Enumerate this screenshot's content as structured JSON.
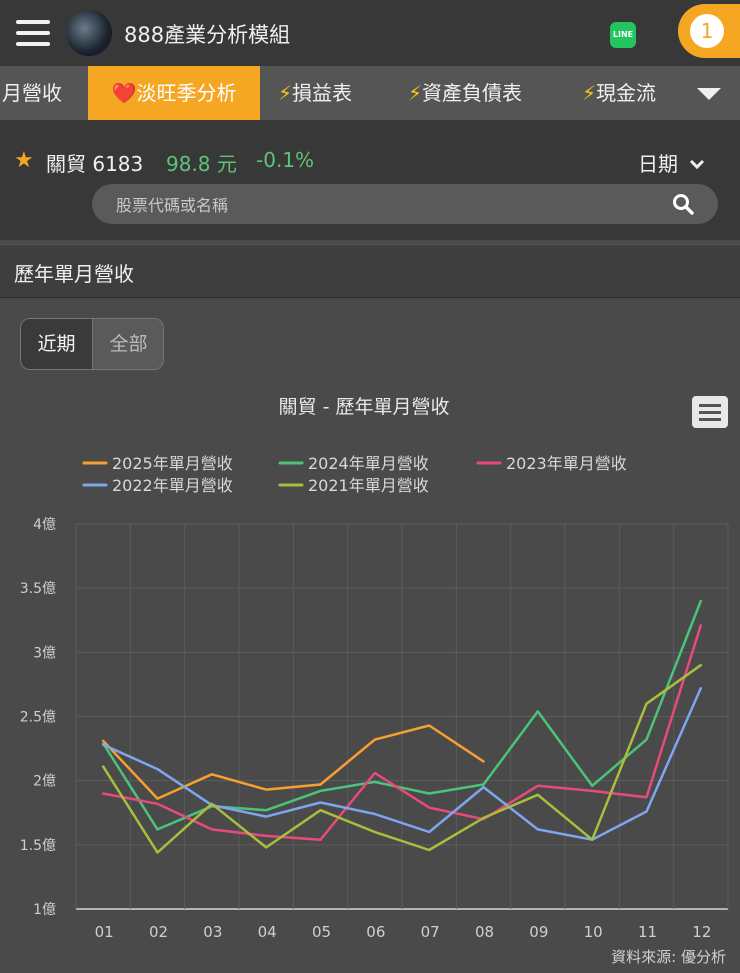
{
  "header": {
    "title": "888產業分析模組",
    "line_badge": "LINE",
    "notification_count": "1"
  },
  "tabs": [
    {
      "label": "月營收",
      "icon": "",
      "active": false
    },
    {
      "label": "淡旺季分析",
      "icon": "❤️",
      "active": true
    },
    {
      "label": "損益表",
      "icon": "⚡",
      "active": false
    },
    {
      "label": "資產負債表",
      "icon": "⚡",
      "active": false
    },
    {
      "label": "現金流",
      "icon": "⚡",
      "active": false
    }
  ],
  "stock": {
    "name": "關貿 6183",
    "price": "98.8 元",
    "change": "-0.1%",
    "date_label": "日期"
  },
  "search": {
    "placeholder": "股票代碼或名稱"
  },
  "section": {
    "title": "歷年單月營收"
  },
  "range_toggle": {
    "recent": "近期",
    "all": "全部"
  },
  "colors": {
    "accent": "#f5a623",
    "up": "#5ec27a"
  },
  "chart_data": {
    "type": "line",
    "title": "關貿 - 歷年單月營收",
    "source": "資料來源: 優分析",
    "categories": [
      "01",
      "02",
      "03",
      "04",
      "05",
      "06",
      "07",
      "08",
      "09",
      "10",
      "11",
      "12"
    ],
    "ylim": [
      1,
      4
    ],
    "yticks": [
      1,
      1.5,
      2,
      2.5,
      3,
      3.5,
      4
    ],
    "ytick_labels": [
      "1億",
      "1.5億",
      "2億",
      "2.5億",
      "3億",
      "3.5億",
      "4億"
    ],
    "grid": true,
    "legend_position": "top",
    "series": [
      {
        "name": "2025年單月營收",
        "color": "#f5a030",
        "values": [
          2.31,
          1.86,
          2.05,
          1.93,
          1.97,
          2.32,
          2.43,
          2.15,
          null,
          null,
          null,
          null
        ]
      },
      {
        "name": "2024年單月營收",
        "color": "#4cc37a",
        "values": [
          2.29,
          1.62,
          1.8,
          1.77,
          1.92,
          1.99,
          1.9,
          1.97,
          2.54,
          1.96,
          2.32,
          3.4
        ]
      },
      {
        "name": "2023年單月營收",
        "color": "#e84a7a",
        "values": [
          1.9,
          1.82,
          1.62,
          1.57,
          1.54,
          2.06,
          1.79,
          1.7,
          1.96,
          1.92,
          1.87,
          3.21
        ]
      },
      {
        "name": "2022年單月營收",
        "color": "#7ea6f0",
        "values": [
          2.28,
          2.09,
          1.81,
          1.72,
          1.83,
          1.74,
          1.6,
          1.95,
          1.62,
          1.54,
          1.76,
          2.72
        ]
      },
      {
        "name": "2021年單月營收",
        "color": "#a8bf3c",
        "values": [
          2.11,
          1.44,
          1.82,
          1.48,
          1.77,
          1.6,
          1.46,
          1.71,
          1.89,
          1.54,
          2.6,
          2.9
        ]
      }
    ]
  }
}
